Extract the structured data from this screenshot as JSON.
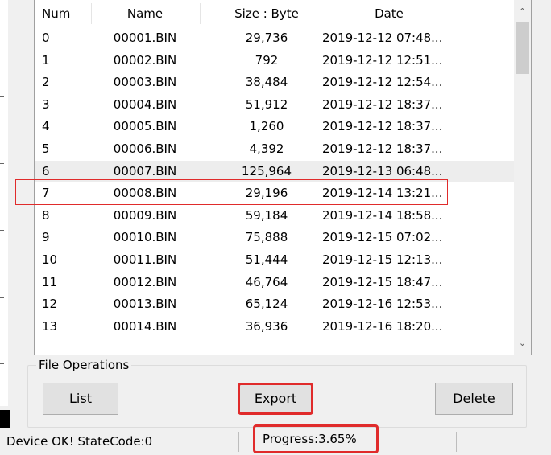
{
  "table": {
    "columns": [
      "Num",
      "Name",
      "Size : Byte",
      "Date"
    ],
    "rows": [
      {
        "num": "0",
        "name": "00001.BIN",
        "size": "29,736",
        "date": "2019-12-12 07:48..."
      },
      {
        "num": "1",
        "name": "00002.BIN",
        "size": "792",
        "date": "2019-12-12 12:51..."
      },
      {
        "num": "2",
        "name": "00003.BIN",
        "size": "38,484",
        "date": "2019-12-12 12:54..."
      },
      {
        "num": "3",
        "name": "00004.BIN",
        "size": "51,912",
        "date": "2019-12-12 18:37..."
      },
      {
        "num": "4",
        "name": "00005.BIN",
        "size": "1,260",
        "date": "2019-12-12 18:37..."
      },
      {
        "num": "5",
        "name": "00006.BIN",
        "size": "4,392",
        "date": "2019-12-12 18:37..."
      },
      {
        "num": "6",
        "name": "00007.BIN",
        "size": "125,964",
        "date": "2019-12-13 06:48..."
      },
      {
        "num": "7",
        "name": "00008.BIN",
        "size": "29,196",
        "date": "2019-12-14 13:21..."
      },
      {
        "num": "8",
        "name": "00009.BIN",
        "size": "59,184",
        "date": "2019-12-14 18:58..."
      },
      {
        "num": "9",
        "name": "00010.BIN",
        "size": "75,888",
        "date": "2019-12-15 07:02..."
      },
      {
        "num": "10",
        "name": "00011.BIN",
        "size": "51,444",
        "date": "2019-12-15 12:13..."
      },
      {
        "num": "11",
        "name": "00012.BIN",
        "size": "46,764",
        "date": "2019-12-15 18:47..."
      },
      {
        "num": "12",
        "name": "00013.BIN",
        "size": "65,124",
        "date": "2019-12-16 12:53..."
      },
      {
        "num": "13",
        "name": "00014.BIN",
        "size": "36,936",
        "date": "2019-12-16 18:20..."
      }
    ],
    "selected_index": 6
  },
  "scrollbar": {
    "up_icon": "chevron-up-icon",
    "down_icon": "chevron-down-icon"
  },
  "file_operations": {
    "title": "File Operations",
    "list_label": "List",
    "export_label": "Export",
    "delete_label": "Delete"
  },
  "status": {
    "device_state": "Device OK! StateCode:0",
    "progress_text": "Progress:3.65%"
  },
  "colors": {
    "highlight": "#e02b2b",
    "selected_row": "#ededed"
  }
}
